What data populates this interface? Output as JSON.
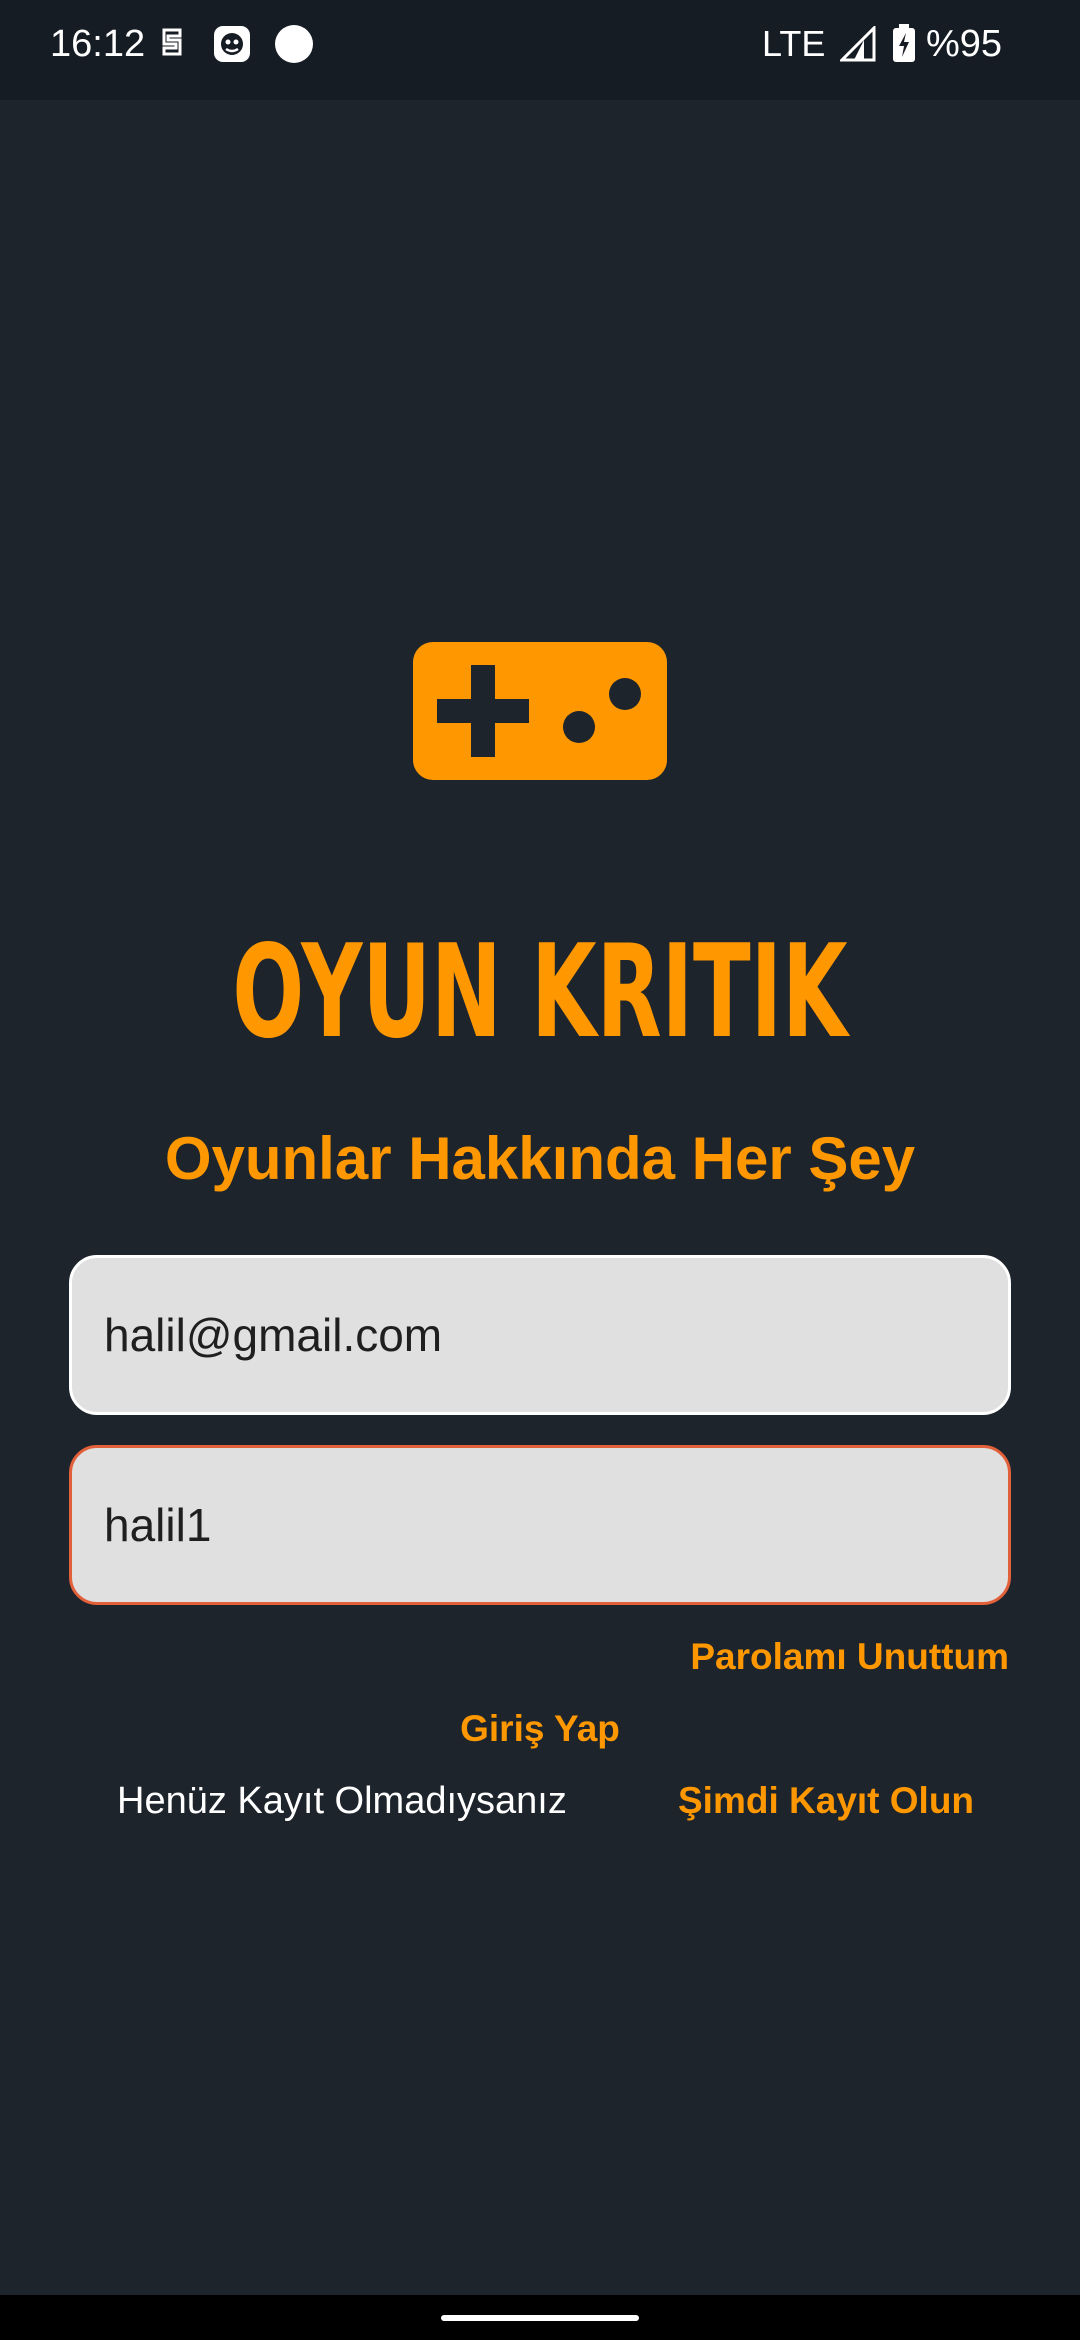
{
  "status_bar": {
    "time": "16:12",
    "network": "LTE",
    "battery": "%95",
    "icons": [
      "sim-icon",
      "face-icon",
      "dot-icon",
      "signal-icon",
      "battery-charging-icon"
    ]
  },
  "logo": {
    "icon": "gamepad-icon",
    "title": "OYUN KRITIK",
    "tagline": "Oyunlar Hakkında Her Şey"
  },
  "form": {
    "email_value": "halil@gmail.com",
    "password_value": "halil1",
    "forgot_label": "Parolamı Unuttum",
    "login_label": "Giriş Yap",
    "register_prompt": "Henüz Kayıt Olmadıysanız",
    "register_label": "Şimdi Kayıt Olun"
  },
  "colors": {
    "accent": "#ff9800",
    "background": "#1d242c",
    "field_bg": "#e0e0e0",
    "error_border": "#e2603a"
  }
}
